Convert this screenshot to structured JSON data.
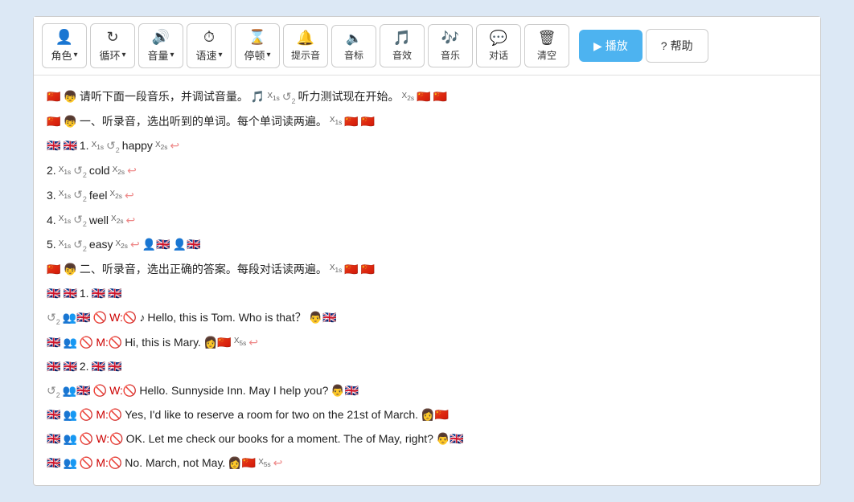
{
  "toolbar": {
    "buttons": [
      {
        "id": "role",
        "icon": "👤",
        "label": "角色",
        "hasArrow": true
      },
      {
        "id": "loop",
        "icon": "🔄",
        "label": "循环",
        "hasArrow": true
      },
      {
        "id": "volume",
        "icon": "🔊",
        "label": "音量",
        "hasArrow": true
      },
      {
        "id": "speed",
        "icon": "⏱",
        "label": "语速",
        "hasArrow": true
      },
      {
        "id": "pause",
        "icon": "⏳",
        "label": "停顿",
        "hasArrow": true
      },
      {
        "id": "tip_audio",
        "icon": "🔔",
        "label": "提示音",
        "hasArrow": false
      },
      {
        "id": "audio_mark",
        "icon": "🔈",
        "label": "音标",
        "hasArrow": false
      },
      {
        "id": "audio_effect",
        "icon": "🎵",
        "label": "音效",
        "hasArrow": false
      },
      {
        "id": "music",
        "icon": "🎶",
        "label": "音乐",
        "hasArrow": false
      },
      {
        "id": "dialog",
        "icon": "💬",
        "label": "对话",
        "hasArrow": false
      },
      {
        "id": "clear",
        "icon": "🗑",
        "label": "清空",
        "hasArrow": false
      }
    ],
    "play_label": "▶ 播放",
    "help_label": "? 帮助"
  },
  "content": {
    "lines": [
      {
        "type": "text",
        "parts": [
          "🇨🇳",
          "👦",
          "请听下面一段音乐，并调试音量。",
          "🎵",
          "X1s",
          "🔄2",
          "听力测试现在开始。",
          "X2s",
          "🇨🇳",
          "🇨🇳"
        ]
      },
      {
        "type": "text",
        "parts": [
          "🇨🇳",
          "👦",
          "一、听录音，选出听到的单词。每个单词读两遍。",
          "X1s",
          "🇨🇳",
          "🇨🇳"
        ]
      },
      {
        "type": "text",
        "parts": [
          "🇬🇧",
          "🇬🇧",
          "1.",
          "X1s",
          "🔄2",
          "happy",
          "X2s",
          "↩"
        ]
      },
      {
        "type": "text",
        "parts": [
          "2.",
          "X1s",
          "🔄2",
          "cold",
          "X2s",
          "↩"
        ]
      },
      {
        "type": "text",
        "parts": [
          "3.",
          "X1s",
          "🔄2",
          "feel",
          "X2s",
          "↩"
        ]
      },
      {
        "type": "text",
        "parts": [
          "4.",
          "X1s",
          "🔄2",
          "well",
          "X2s",
          "↩"
        ]
      },
      {
        "type": "text",
        "parts": [
          "5.",
          "X1s",
          "🔄2",
          "easy",
          "X2s",
          "↩",
          "👤🇬🇧",
          "👤🇬🇧"
        ]
      },
      {
        "type": "text",
        "parts": [
          "🇨🇳",
          "👦",
          "二、听录音，选出正确的答案。每段对话读两遍。",
          "X1s",
          "🇨🇳",
          "🇨🇳"
        ]
      },
      {
        "type": "text",
        "parts": [
          "🇬🇧",
          "🇬🇧",
          "1.",
          "🇬🇧",
          "🇬🇧"
        ]
      },
      {
        "type": "text",
        "parts": [
          "🔄2",
          "👥🇬🇧",
          "🚫",
          "W:🚫",
          "♪",
          "Hello, this is Tom. Who is that？",
          "👨🇬🇧"
        ]
      },
      {
        "type": "text",
        "parts": [
          "🇬🇧",
          "👥",
          "🚫",
          "M:🚫",
          "Hi, this is Mary.",
          "👩🇨🇳",
          "X5s",
          "↩"
        ]
      },
      {
        "type": "text",
        "parts": [
          "🇬🇧",
          "🇬🇧",
          "2.",
          "🇬🇧",
          "🇬🇧"
        ]
      },
      {
        "type": "text",
        "parts": [
          "🔄2",
          "👥🇬🇧",
          "🚫",
          "W:🚫",
          "Hello. Sunnyside Inn. May I help you?",
          "👨🇬🇧"
        ]
      },
      {
        "type": "text",
        "parts": [
          "🇬🇧",
          "👥",
          "🚫",
          "M:🚫",
          "Yes, I'd like to reserve a room for two on the 21st of March.",
          "👩🇨🇳"
        ]
      },
      {
        "type": "text",
        "parts": [
          "🇬🇧",
          "👥",
          "🚫",
          "W:🚫",
          "OK. Let me check our books for a moment. The of May, right?",
          "👨🇬🇧"
        ]
      },
      {
        "type": "text",
        "parts": [
          "🇬🇧",
          "👥",
          "🚫",
          "M:🚫",
          "No. March, not May.",
          "👩🇨🇳",
          "X5s",
          "↩"
        ]
      }
    ]
  }
}
